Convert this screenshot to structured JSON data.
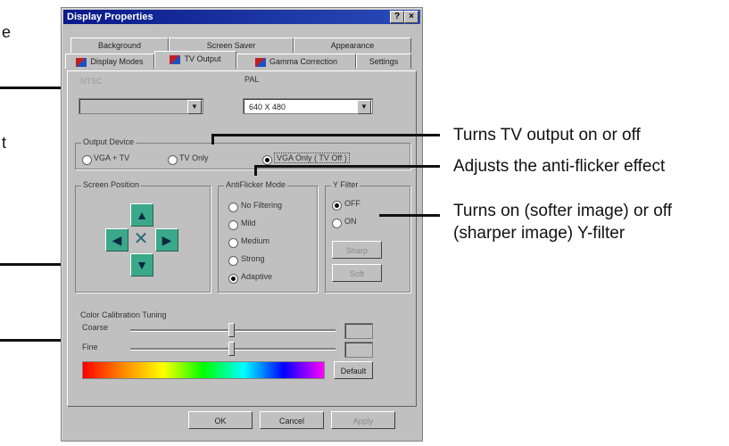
{
  "left_fragments": {
    "frag1": "e",
    "frag2": "t"
  },
  "annotations": {
    "tv_output": "Turns TV output on or off",
    "anti_flicker": "Adjusts the anti-flicker effect",
    "y_filter_line1": "Turns on (softer image) or off",
    "y_filter_line2": "(sharper image) Y-filter"
  },
  "window": {
    "title": "Display Properties",
    "help_btn": "?",
    "close_btn": "×"
  },
  "tabs": {
    "background": "Background",
    "screen_saver": "Screen Saver",
    "appearance": "Appearance",
    "display_modes": "Display Modes",
    "tv_output": "TV Output",
    "gamma_correction": "Gamma Correction",
    "settings": "Settings"
  },
  "tv_output": {
    "ntsc_label": "NTSC",
    "pal_label": "PAL",
    "pal_value": "640 X 480",
    "output_device_label": "Output Device",
    "vga_tv": "VGA + TV",
    "tv_only": "TV Only",
    "vga_only": "VGA Only ( TV Off )",
    "screen_position_label": "Screen Position",
    "antiflicker_label": "AntiFlicker Mode",
    "no_filtering": "No Filtering",
    "mild": "Mild",
    "medium": "Medium",
    "strong": "Strong",
    "adaptive": "Adaptive",
    "yfilter_label": "Y Filter",
    "off": "OFF",
    "on": "ON",
    "sharp_btn": "Sharp",
    "soft_btn": "Soft",
    "color_cal_label": "Color Calibration Tuning",
    "coarse": "Coarse",
    "fine": "Fine",
    "default_btn": "Default"
  },
  "footer": {
    "ok": "OK",
    "cancel": "Cancel",
    "apply": "Apply"
  }
}
